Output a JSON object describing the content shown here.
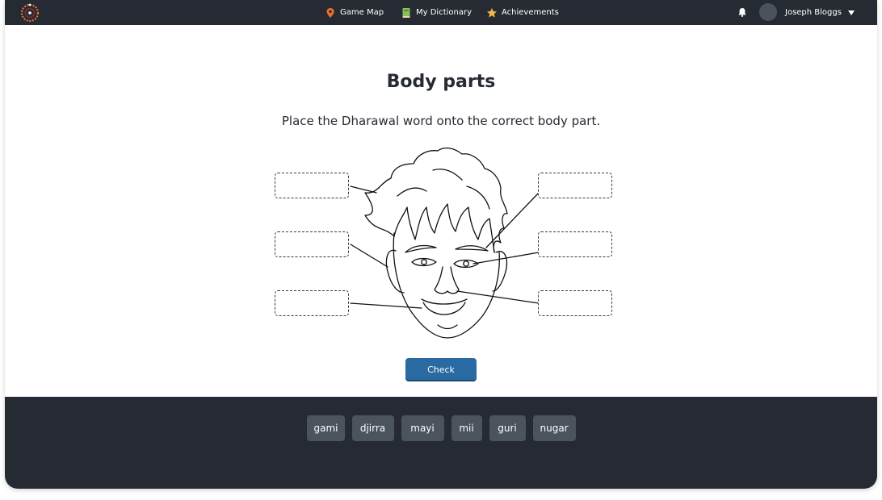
{
  "nav": {
    "game_map": "Game Map",
    "my_dictionary": "My Dictionary",
    "achievements": "Achievements",
    "user_name": "Joseph Bloggs"
  },
  "colors": {
    "topbar": "#262b33",
    "accent_button": "#2a6aa3",
    "chip_bg": "#4b535d",
    "map_pin": "#e8702a",
    "star": "#f5b942",
    "dictionary": "#8bbf5a"
  },
  "icons": {
    "logo": "circular-dotted-logo",
    "game_map": "map-pin-icon",
    "my_dictionary": "book-icon",
    "achievements": "star-icon",
    "notifications": "bell-icon",
    "menu": "chevron-down-icon"
  },
  "activity": {
    "title": "Body parts",
    "instruction": "Place the Dharawal word onto the correct body part.",
    "check_label": "Check"
  },
  "words": [
    "gami",
    "djirra",
    "mayi",
    "mii",
    "guri",
    "nugar"
  ]
}
